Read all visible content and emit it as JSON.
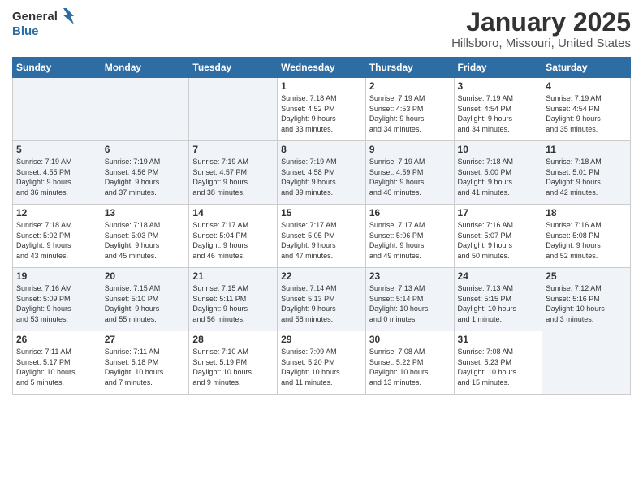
{
  "app": {
    "logo_general": "General",
    "logo_blue": "Blue",
    "month": "January 2025",
    "location": "Hillsboro, Missouri, United States"
  },
  "calendar": {
    "headers": [
      "Sunday",
      "Monday",
      "Tuesday",
      "Wednesday",
      "Thursday",
      "Friday",
      "Saturday"
    ],
    "weeks": [
      [
        {
          "day": "",
          "info": ""
        },
        {
          "day": "",
          "info": ""
        },
        {
          "day": "",
          "info": ""
        },
        {
          "day": "1",
          "info": "Sunrise: 7:18 AM\nSunset: 4:52 PM\nDaylight: 9 hours\nand 33 minutes."
        },
        {
          "day": "2",
          "info": "Sunrise: 7:19 AM\nSunset: 4:53 PM\nDaylight: 9 hours\nand 34 minutes."
        },
        {
          "day": "3",
          "info": "Sunrise: 7:19 AM\nSunset: 4:54 PM\nDaylight: 9 hours\nand 34 minutes."
        },
        {
          "day": "4",
          "info": "Sunrise: 7:19 AM\nSunset: 4:54 PM\nDaylight: 9 hours\nand 35 minutes."
        }
      ],
      [
        {
          "day": "5",
          "info": "Sunrise: 7:19 AM\nSunset: 4:55 PM\nDaylight: 9 hours\nand 36 minutes."
        },
        {
          "day": "6",
          "info": "Sunrise: 7:19 AM\nSunset: 4:56 PM\nDaylight: 9 hours\nand 37 minutes."
        },
        {
          "day": "7",
          "info": "Sunrise: 7:19 AM\nSunset: 4:57 PM\nDaylight: 9 hours\nand 38 minutes."
        },
        {
          "day": "8",
          "info": "Sunrise: 7:19 AM\nSunset: 4:58 PM\nDaylight: 9 hours\nand 39 minutes."
        },
        {
          "day": "9",
          "info": "Sunrise: 7:19 AM\nSunset: 4:59 PM\nDaylight: 9 hours\nand 40 minutes."
        },
        {
          "day": "10",
          "info": "Sunrise: 7:18 AM\nSunset: 5:00 PM\nDaylight: 9 hours\nand 41 minutes."
        },
        {
          "day": "11",
          "info": "Sunrise: 7:18 AM\nSunset: 5:01 PM\nDaylight: 9 hours\nand 42 minutes."
        }
      ],
      [
        {
          "day": "12",
          "info": "Sunrise: 7:18 AM\nSunset: 5:02 PM\nDaylight: 9 hours\nand 43 minutes."
        },
        {
          "day": "13",
          "info": "Sunrise: 7:18 AM\nSunset: 5:03 PM\nDaylight: 9 hours\nand 45 minutes."
        },
        {
          "day": "14",
          "info": "Sunrise: 7:17 AM\nSunset: 5:04 PM\nDaylight: 9 hours\nand 46 minutes."
        },
        {
          "day": "15",
          "info": "Sunrise: 7:17 AM\nSunset: 5:05 PM\nDaylight: 9 hours\nand 47 minutes."
        },
        {
          "day": "16",
          "info": "Sunrise: 7:17 AM\nSunset: 5:06 PM\nDaylight: 9 hours\nand 49 minutes."
        },
        {
          "day": "17",
          "info": "Sunrise: 7:16 AM\nSunset: 5:07 PM\nDaylight: 9 hours\nand 50 minutes."
        },
        {
          "day": "18",
          "info": "Sunrise: 7:16 AM\nSunset: 5:08 PM\nDaylight: 9 hours\nand 52 minutes."
        }
      ],
      [
        {
          "day": "19",
          "info": "Sunrise: 7:16 AM\nSunset: 5:09 PM\nDaylight: 9 hours\nand 53 minutes."
        },
        {
          "day": "20",
          "info": "Sunrise: 7:15 AM\nSunset: 5:10 PM\nDaylight: 9 hours\nand 55 minutes."
        },
        {
          "day": "21",
          "info": "Sunrise: 7:15 AM\nSunset: 5:11 PM\nDaylight: 9 hours\nand 56 minutes."
        },
        {
          "day": "22",
          "info": "Sunrise: 7:14 AM\nSunset: 5:13 PM\nDaylight: 9 hours\nand 58 minutes."
        },
        {
          "day": "23",
          "info": "Sunrise: 7:13 AM\nSunset: 5:14 PM\nDaylight: 10 hours\nand 0 minutes."
        },
        {
          "day": "24",
          "info": "Sunrise: 7:13 AM\nSunset: 5:15 PM\nDaylight: 10 hours\nand 1 minute."
        },
        {
          "day": "25",
          "info": "Sunrise: 7:12 AM\nSunset: 5:16 PM\nDaylight: 10 hours\nand 3 minutes."
        }
      ],
      [
        {
          "day": "26",
          "info": "Sunrise: 7:11 AM\nSunset: 5:17 PM\nDaylight: 10 hours\nand 5 minutes."
        },
        {
          "day": "27",
          "info": "Sunrise: 7:11 AM\nSunset: 5:18 PM\nDaylight: 10 hours\nand 7 minutes."
        },
        {
          "day": "28",
          "info": "Sunrise: 7:10 AM\nSunset: 5:19 PM\nDaylight: 10 hours\nand 9 minutes."
        },
        {
          "day": "29",
          "info": "Sunrise: 7:09 AM\nSunset: 5:20 PM\nDaylight: 10 hours\nand 11 minutes."
        },
        {
          "day": "30",
          "info": "Sunrise: 7:08 AM\nSunset: 5:22 PM\nDaylight: 10 hours\nand 13 minutes."
        },
        {
          "day": "31",
          "info": "Sunrise: 7:08 AM\nSunset: 5:23 PM\nDaylight: 10 hours\nand 15 minutes."
        },
        {
          "day": "",
          "info": ""
        }
      ]
    ]
  }
}
